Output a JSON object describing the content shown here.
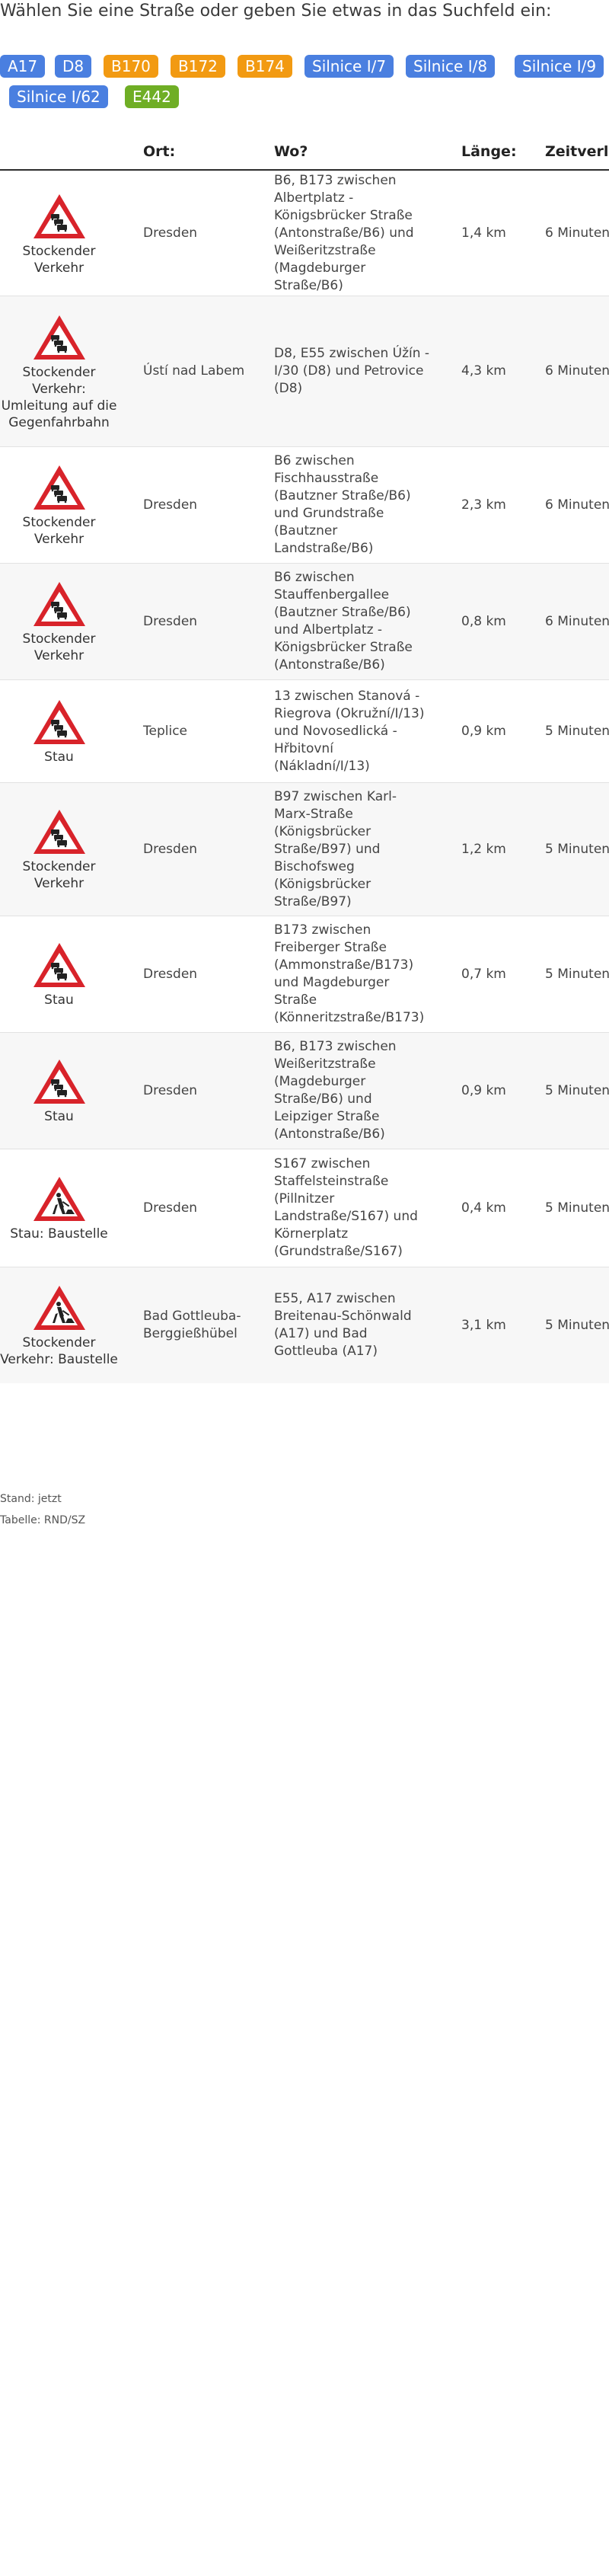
{
  "prompt": "Wählen Sie eine Straße oder geben Sie etwas in das Suchfeld ein:",
  "chips": [
    {
      "label": "A17",
      "color": "#4a7fe0"
    },
    {
      "label": "D8",
      "color": "#4a7fe0"
    },
    {
      "label": "B170",
      "color": "#f29a12"
    },
    {
      "label": "B172",
      "color": "#f29a12"
    },
    {
      "label": "B174",
      "color": "#f29a12"
    },
    {
      "label": "Silnice I/7",
      "color": "#4a7fe0"
    },
    {
      "label": "Silnice I/8",
      "color": "#4a7fe0"
    },
    {
      "label": "Silnice I/9",
      "color": "#4a7fe0"
    },
    {
      "label": "Silnice I/62",
      "color": "#4a7fe0"
    },
    {
      "label": "E442",
      "color": "#6fae25"
    }
  ],
  "table": {
    "headers": {
      "ort": "Ort:",
      "wo": "Wo?",
      "laenge": "Länge:",
      "zeit": "Zeitverlu"
    },
    "rows": [
      {
        "icon": "traffic-jam-icon",
        "label": "Stockender Verkehr",
        "ort": "Dresden",
        "wo": "B6, B173 zwischen Albertplatz - Königsbrücker Straße (Antonstraße/B6) und Weißeritzstraße (Magdeburger Straße/B6)",
        "laenge": "1,4 km",
        "zeit": "6 Minuten"
      },
      {
        "icon": "traffic-jam-icon",
        "label": "Stockender Verkehr: Umleitung auf die Gegenfahrbahn",
        "ort": "Ústí nad Labem",
        "wo": "D8, E55 zwischen Úžín - I/30 (D8) und Petrovice (D8)",
        "laenge": "4,3 km",
        "zeit": "6 Minuten"
      },
      {
        "icon": "traffic-jam-icon",
        "label": "Stockender Verkehr",
        "ort": "Dresden",
        "wo": "B6 zwischen Fischhausstraße (Bautzner Straße/B6) und Grundstraße (Bautzner Landstraße/B6)",
        "laenge": "2,3 km",
        "zeit": "6 Minuten"
      },
      {
        "icon": "traffic-jam-icon",
        "label": "Stockender Verkehr",
        "ort": "Dresden",
        "wo": "B6 zwischen Stauffenbergallee (Bautzner Straße/B6) und Albertplatz - Königsbrücker Straße (Antonstraße/B6)",
        "laenge": "0,8 km",
        "zeit": "6 Minuten"
      },
      {
        "icon": "traffic-jam-icon",
        "label": "Stau",
        "ort": "Teplice",
        "wo": "13 zwischen Stanová - Riegrova (Okružní/I/13) und Novosedlická - Hřbitovní (Nákladní/I/13)",
        "laenge": "0,9 km",
        "zeit": "5 Minuten"
      },
      {
        "icon": "traffic-jam-icon",
        "label": "Stockender Verkehr",
        "ort": "Dresden",
        "wo": "B97 zwischen Karl-Marx-Straße (Königsbrücker Straße/B97) und Bischofsweg (Königsbrücker Straße/B97)",
        "laenge": "1,2 km",
        "zeit": "5 Minuten"
      },
      {
        "icon": "traffic-jam-icon",
        "label": "Stau",
        "ort": "Dresden",
        "wo": "B173 zwischen Freiberger Straße (Ammonstraße/B173) und Magdeburger Straße (Könneritzstraße/B173)",
        "laenge": "0,7 km",
        "zeit": "5 Minuten"
      },
      {
        "icon": "traffic-jam-icon",
        "label": "Stau",
        "ort": "Dresden",
        "wo": "B6, B173 zwischen Weißeritzstraße (Magdeburger Straße/B6) und Leipziger Straße (Antonstraße/B6)",
        "laenge": "0,9 km",
        "zeit": "5 Minuten"
      },
      {
        "icon": "roadworks-icon",
        "label": "Stau: Baustelle",
        "ort": "Dresden",
        "wo": "S167 zwischen Staffelsteinstraße (Pillnitzer Landstraße/S167) und Körnerplatz (Grundstraße/S167)",
        "laenge": "0,4 km",
        "zeit": "5 Minuten"
      },
      {
        "icon": "roadworks-icon",
        "label": "Stockender Verkehr: Baustelle",
        "ort": "Bad Gottleuba-Berggießhübel",
        "wo": "E55, A17 zwischen Breitenau-Schönwald (A17) und Bad Gottleuba (A17)",
        "laenge": "3,1 km",
        "zeit": "5 Minuten"
      }
    ]
  },
  "footer": {
    "stand": "Stand: jetzt",
    "tabelle": "Tabelle: RND/SZ"
  }
}
